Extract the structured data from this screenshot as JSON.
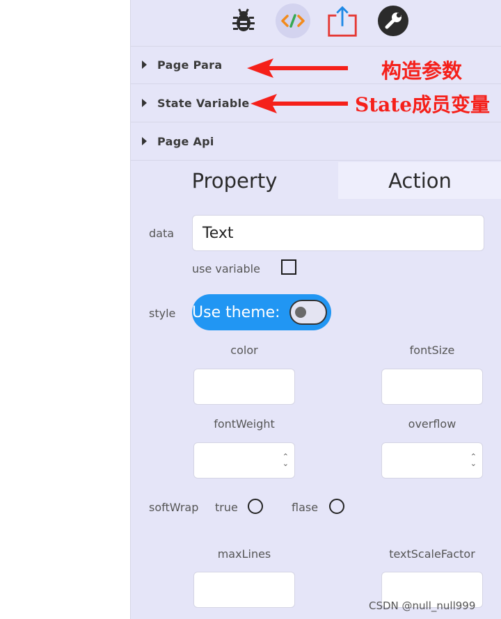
{
  "toolbar": {
    "icons": [
      "bug-icon",
      "code-icon",
      "share-upload-icon",
      "wrench-icon"
    ],
    "active_icon": "code-icon",
    "code_icon_text": "</>"
  },
  "sections": {
    "page_para": "Page Para",
    "state_variable": "State Variable",
    "page_api": "Page Api"
  },
  "annotations": {
    "page_para_note": "构造参数",
    "state_variable_note": "State成员变量",
    "color": "#f5201a"
  },
  "tabs": {
    "property": "Property",
    "action": "Action",
    "active": "property"
  },
  "form": {
    "data_label": "data",
    "data_value": "Text",
    "use_variable_label": "use variable",
    "use_variable_checked": false,
    "style_label": "style",
    "use_theme_label": "Use theme:",
    "use_theme_on": false,
    "color_label": "color",
    "color_value": "",
    "font_size_label": "fontSize",
    "font_size_value": "",
    "font_weight_label": "fontWeight",
    "font_weight_value": "",
    "overflow_label": "overflow",
    "overflow_value": "",
    "soft_wrap_label": "softWrap",
    "soft_wrap_true": "true",
    "soft_wrap_false": "flase",
    "soft_wrap_selected": "",
    "max_lines_label": "maxLines",
    "max_lines_value": "",
    "text_scale_factor_label": "textScaleFactor",
    "text_scale_factor_value": ""
  },
  "watermark": "CSDN @null_null999",
  "colors": {
    "panel_bg": "#e5e5f8",
    "toggle_blue": "#2196f3"
  }
}
